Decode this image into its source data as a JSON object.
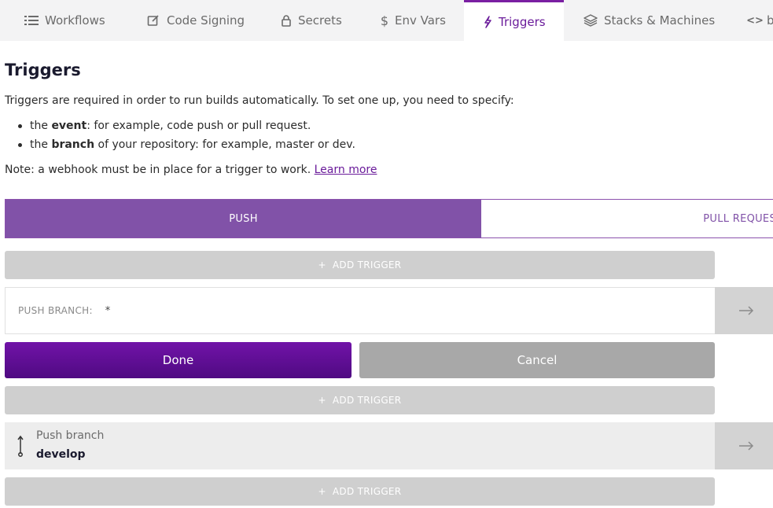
{
  "tabs": [
    {
      "label": "Workflows",
      "icon": "list-icon",
      "active": false
    },
    {
      "label": "Code Signing",
      "icon": "edit-icon",
      "active": false
    },
    {
      "label": "Secrets",
      "icon": "lock-icon",
      "active": false
    },
    {
      "label": "Env Vars",
      "icon": "dollar-icon",
      "active": false
    },
    {
      "label": "Triggers",
      "icon": "lightning-icon",
      "active": true
    },
    {
      "label": "Stacks & Machines",
      "icon": "layers-icon",
      "active": false
    },
    {
      "label": "b",
      "icon": "code-icon",
      "active": false
    }
  ],
  "page": {
    "title": "Triggers",
    "intro": "Triggers are required in order to run builds automatically. To set one up, you need to specify:",
    "bullet_1": {
      "pre": "the ",
      "bold": "event",
      "post": ": for example, code push or pull request."
    },
    "bullet_2": {
      "pre": "the ",
      "bold": "branch",
      "post": " of your repository: for example, master or dev."
    },
    "note_text": "Note: a webhook must be in place for a trigger to work. ",
    "note_link": "Learn more"
  },
  "segment": {
    "push_label": "PUSH",
    "pull_label": "PULL REQUES"
  },
  "add_trigger": {
    "plus": "+",
    "label": "ADD TRIGGER"
  },
  "editor": {
    "branch_label": "PUSH BRANCH:",
    "branch_value": "*",
    "done_label": "Done",
    "cancel_label": "Cancel"
  },
  "trigger_item": {
    "label": "Push branch",
    "value": "develop"
  },
  "colors": {
    "accent": "#6a1b9a",
    "segment_active": "#8152a8",
    "add_trigger_bg": "#cfcfcf",
    "done_bg": "#5e0f92",
    "cancel_bg": "#a8a8a8"
  }
}
